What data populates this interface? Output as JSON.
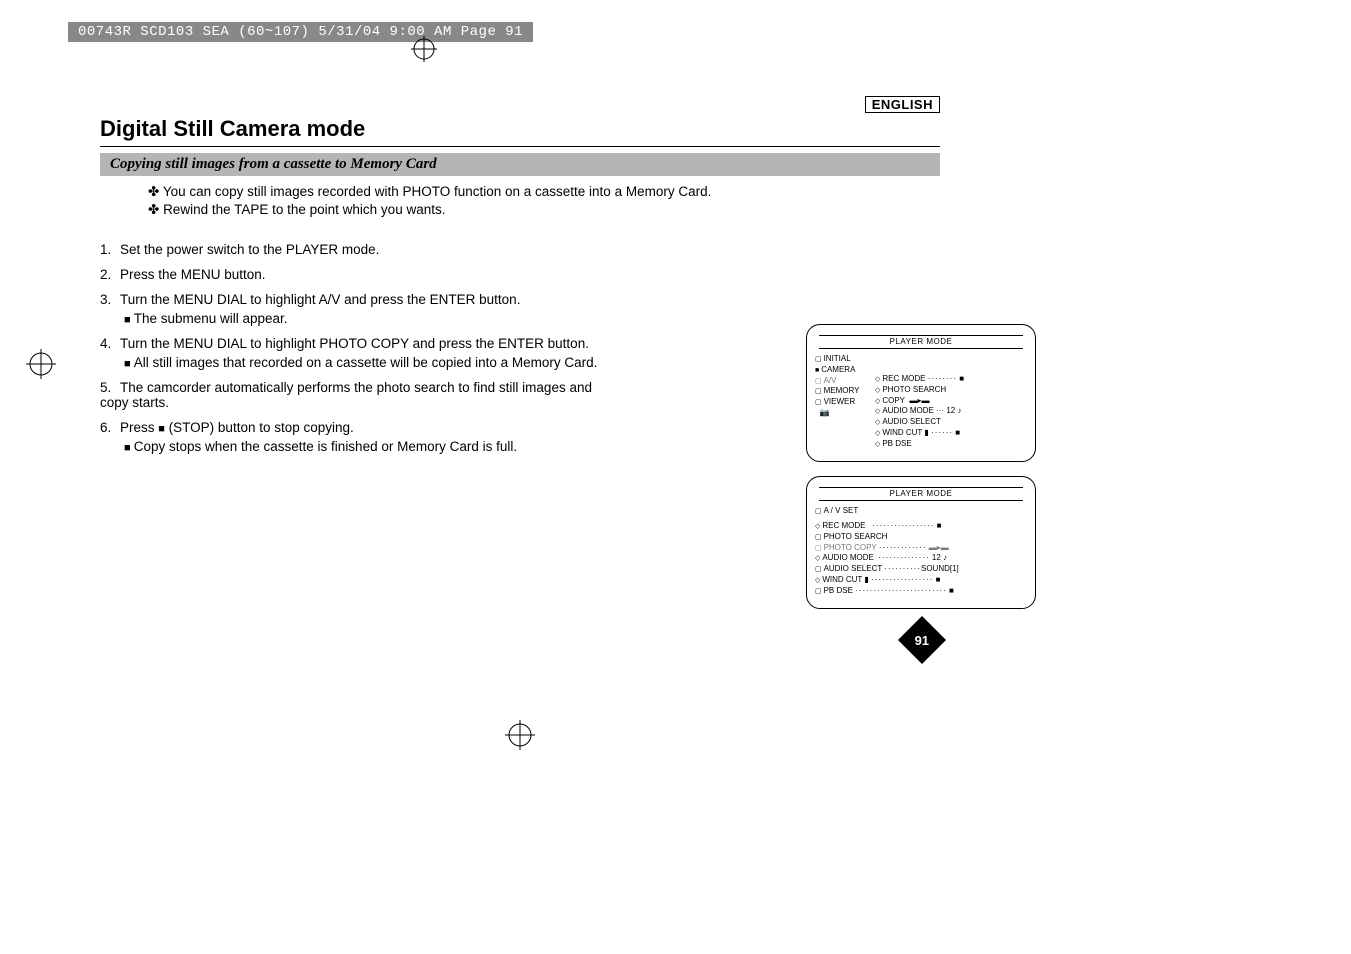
{
  "print_header": "00743R SCD103 SEA (60~107)   5/31/04 9:00 AM   Page 91",
  "language_badge": "ENGLISH",
  "title": "Digital Still Camera mode",
  "subtitle": "Copying still images from a cassette to Memory Card",
  "intro": [
    "You can copy still images recorded with PHOTO function on a cassette into a Memory Card.",
    "Rewind the TAPE to the point which you wants."
  ],
  "steps": [
    {
      "num": "1.",
      "text": "Set the power switch to the PLAYER mode."
    },
    {
      "num": "2.",
      "text": "Press the MENU button."
    },
    {
      "num": "3.",
      "text": "Turn the MENU DIAL to highlight A/V and press the ENTER button.",
      "sub": "The submenu will appear."
    },
    {
      "num": "4.",
      "text": "Turn the MENU DIAL to highlight PHOTO COPY and press the ENTER button.",
      "sub": "All still images that recorded on a cassette will be copied into a Memory Card."
    },
    {
      "num": "5.",
      "text": "The camcorder automatically performs the photo search to find still images and copy starts."
    },
    {
      "num": "6.",
      "text_pre": "Press  ",
      "text_post": " (STOP) button to stop copying.",
      "sub": "Copy stops when the cassette is finished or Memory Card is full."
    }
  ],
  "lcd1": {
    "header": "PLAYER  MODE",
    "left": [
      "INITIAL",
      "CAMERA",
      "A/V",
      "MEMORY",
      "VIEWER"
    ],
    "right": [
      "REC MODE",
      "PHOTO SEARCH",
      "COPY",
      "AUDIO MODE",
      "AUDIO SELECT",
      "WIND CUT",
      "PB DSE"
    ],
    "audio_mode_val": "12"
  },
  "lcd2": {
    "header": "PLAYER  MODE",
    "section": "A / V  SET",
    "items": [
      {
        "label": "REC MODE",
        "val": ""
      },
      {
        "label": "PHOTO SEARCH",
        "val": ""
      },
      {
        "label": "PHOTO COPY",
        "val": "",
        "hl": true
      },
      {
        "label": "AUDIO MODE",
        "val": "12"
      },
      {
        "label": "AUDIO SELECT",
        "val": "SOUND[1]"
      },
      {
        "label": "WIND CUT",
        "val": ""
      },
      {
        "label": "PB DSE",
        "val": ""
      }
    ]
  },
  "page_number": "91"
}
